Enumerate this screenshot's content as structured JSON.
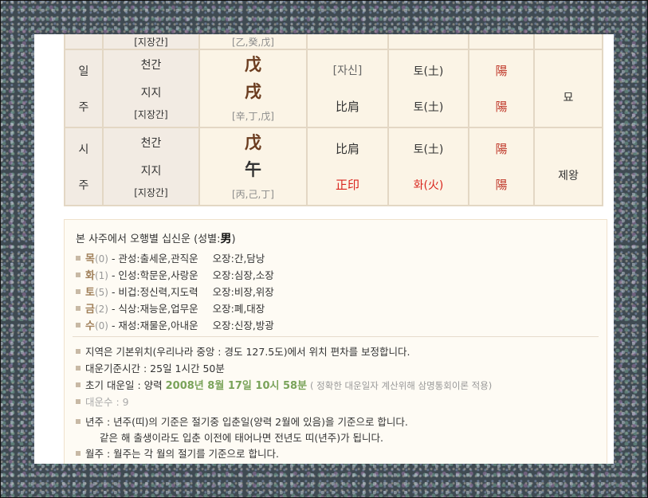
{
  "pillars_table": {
    "top_partial": {
      "hidden_label": "[지장간]",
      "hidden_stems": "[乙,癸,戊]"
    },
    "day": {
      "side": [
        "일",
        "주"
      ],
      "stem_label": "천간",
      "branch_label": "지지",
      "hidden_label": "[지장간]",
      "stem_hanja": "戊",
      "branch_hanja": "戌",
      "hidden_stems": "[辛,丁,戊]",
      "stem_god": "[자신]",
      "branch_god": "比肩",
      "stem_element": "토(土)",
      "branch_element": "토(土)",
      "stem_yinyang": "陽",
      "branch_yinyang": "陽",
      "twelve_stage": "묘"
    },
    "hour": {
      "side": [
        "시",
        "주"
      ],
      "stem_label": "천간",
      "branch_label": "지지",
      "hidden_label": "[지장간]",
      "stem_hanja": "戊",
      "branch_hanja": "午",
      "hidden_stems": "[丙,己,丁]",
      "stem_god": "比肩",
      "branch_god": "正印",
      "stem_element": "토(土)",
      "branch_element": "화(火)",
      "stem_yinyang": "陽",
      "branch_yinyang": "陽",
      "twelve_stage": "제왕"
    }
  },
  "elements_box": {
    "heading_prefix": "본 사주에서 오행별 십신운 (성별:",
    "gender": "男",
    "heading_suffix": ")",
    "rows": [
      {
        "name": "목",
        "count": "(0)",
        "desc": "- 관성:출세운,관직운",
        "organs": "오장:간,담낭",
        "color": "#a0805a"
      },
      {
        "name": "화",
        "count": "(1)",
        "desc": "- 인성:학문운,사랑운",
        "organs": "오장:심장,소장",
        "color": "#a0805a"
      },
      {
        "name": "토",
        "count": "(5)",
        "desc": "- 비겁:정신력,지도력",
        "organs": "오장:비장,위장",
        "color": "#a0805a"
      },
      {
        "name": "금",
        "count": "(2)",
        "desc": "- 식상:재능운,업무운",
        "organs": "오장:폐,대장",
        "color": "#a0805a"
      },
      {
        "name": "수",
        "count": "(0)",
        "desc": "- 재성:재물운,아내운",
        "organs": "오장:신장,방광",
        "color": "#a0805a"
      }
    ],
    "notes": {
      "region": "지역은 기본위치(우리나라 중앙 : 경도 127.5도)에서 위치 편차를 보정합니다.",
      "daeun_base": "대운기준시간 : 25일 1시간 50분",
      "first_daeun_label": "초기 대운일 : 양력",
      "first_daeun_date": "2008년 8월 17일 10시 58분",
      "first_daeun_note": "( 정확한 대운일자 계산위해 삼명통회이론 적용)",
      "daeun_number": "대운수 : 9",
      "year_rule": "년주 : 년주(띠)의 기준은 절기중 입춘일(양력 2월에 있음)을 기준으로 합니다.",
      "year_rule_2": "같은 해 출생이라도 입춘 이전에 태어나면 전년도 띠(년주)가 됩니다.",
      "month_rule": "월주 : 월주는 각 월의 절기를 기준으로 합니다."
    }
  }
}
